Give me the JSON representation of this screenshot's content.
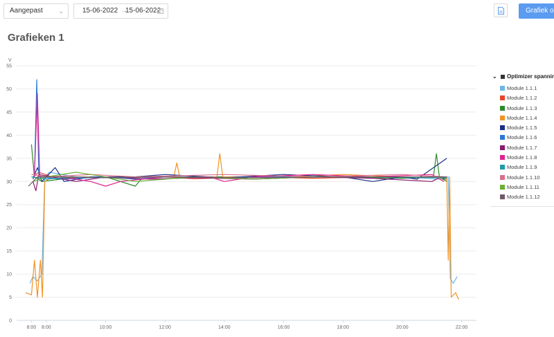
{
  "toolbar": {
    "period_select": "Aangepast",
    "date_from": "15-06-2022",
    "date_arrow": "→",
    "date_to": "15-06-2022",
    "primary_button": "Grafiek ops"
  },
  "page_title": "Grafieken 1",
  "legend": {
    "group_label": "Optimizer spanning",
    "items": [
      {
        "label": "Module 1.1.1",
        "color": "#6cb6e8"
      },
      {
        "label": "Module 1.1.2",
        "color": "#e8452a"
      },
      {
        "label": "Module 1.1.3",
        "color": "#2a8a2a"
      },
      {
        "label": "Module 1.1.4",
        "color": "#f29222"
      },
      {
        "label": "Module 1.1.5",
        "color": "#1b2f8a"
      },
      {
        "label": "Module 1.1.6",
        "color": "#2a78d8"
      },
      {
        "label": "Module 1.1.7",
        "color": "#8a1a6e"
      },
      {
        "label": "Module 1.1.8",
        "color": "#e0238f"
      },
      {
        "label": "Module 1.1.9",
        "color": "#1f9ca8"
      },
      {
        "label": "Module 1.1.10",
        "color": "#d9708a"
      },
      {
        "label": "Module 1.1.11",
        "color": "#6bb035"
      },
      {
        "label": "Module 1.1.12",
        "color": "#6e5a6a"
      }
    ]
  },
  "chart_data": {
    "type": "line",
    "ylabel": "V",
    "ylim": [
      0,
      55
    ],
    "yticks": [
      "0",
      "5",
      "10",
      "15",
      "20",
      "25",
      "30",
      "35",
      "40",
      "45",
      "50",
      "55"
    ],
    "xlim": [
      "7:00",
      "22:30"
    ],
    "xticks": [
      "8:00",
      "8:00",
      "10:00",
      "12:00",
      "14:00",
      "16:00",
      "18:00",
      "20:00",
      "22:00"
    ],
    "grid": "horizontal",
    "series": [
      {
        "name": "Module 1.1.1",
        "color": "#6cb6e8",
        "points": [
          [
            7.45,
            8
          ],
          [
            7.55,
            9.5
          ],
          [
            7.7,
            8.5
          ],
          [
            7.85,
            10
          ],
          [
            7.95,
            31
          ],
          [
            8.1,
            32
          ],
          [
            9,
            31
          ],
          [
            12,
            31
          ],
          [
            16,
            31
          ],
          [
            20,
            31
          ],
          [
            21.3,
            30.5
          ],
          [
            21.55,
            31
          ],
          [
            21.62,
            9
          ],
          [
            21.72,
            8
          ],
          [
            21.85,
            9.5
          ]
        ]
      },
      {
        "name": "Module 1.1.2",
        "color": "#e8452a",
        "points": [
          [
            7.55,
            31
          ],
          [
            7.75,
            32
          ],
          [
            8.4,
            30.5
          ],
          [
            9.2,
            31
          ],
          [
            10.5,
            30.8
          ],
          [
            12,
            31
          ],
          [
            13,
            30.6
          ],
          [
            15,
            31
          ],
          [
            17,
            30.7
          ],
          [
            19,
            31
          ],
          [
            20.5,
            30.8
          ],
          [
            21.5,
            31
          ]
        ]
      },
      {
        "name": "Module 1.1.3",
        "color": "#2a8a2a",
        "points": [
          [
            7.5,
            38
          ],
          [
            7.6,
            31
          ],
          [
            7.85,
            30
          ],
          [
            8.5,
            30.5
          ],
          [
            10,
            31
          ],
          [
            11,
            29
          ],
          [
            11.2,
            30.5
          ],
          [
            12,
            31
          ],
          [
            15,
            31
          ],
          [
            18,
            31
          ],
          [
            20,
            30.7
          ],
          [
            21.05,
            31
          ],
          [
            21.15,
            36
          ],
          [
            21.25,
            31
          ],
          [
            21.5,
            30.5
          ]
        ]
      },
      {
        "name": "Module 1.1.4",
        "color": "#f29222",
        "points": [
          [
            7.3,
            6
          ],
          [
            7.5,
            5.5
          ],
          [
            7.6,
            13
          ],
          [
            7.7,
            5
          ],
          [
            7.8,
            13
          ],
          [
            7.87,
            5
          ],
          [
            7.95,
            30
          ],
          [
            8.2,
            31
          ],
          [
            11,
            31
          ],
          [
            12.3,
            31
          ],
          [
            12.4,
            34
          ],
          [
            12.5,
            31
          ],
          [
            13.75,
            31
          ],
          [
            13.85,
            36
          ],
          [
            13.95,
            31
          ],
          [
            16,
            31
          ],
          [
            18,
            31.5
          ],
          [
            20,
            31
          ],
          [
            21.5,
            31
          ],
          [
            21.55,
            13
          ],
          [
            21.6,
            31
          ],
          [
            21.65,
            5
          ],
          [
            21.8,
            6
          ],
          [
            21.9,
            4.5
          ]
        ]
      },
      {
        "name": "Module 1.1.5",
        "color": "#1b2f8a",
        "points": [
          [
            7.55,
            30.5
          ],
          [
            7.7,
            33
          ],
          [
            7.85,
            30
          ],
          [
            8.3,
            33
          ],
          [
            8.6,
            30
          ],
          [
            9.5,
            31
          ],
          [
            11,
            31
          ],
          [
            12,
            31.5
          ],
          [
            14,
            30.8
          ],
          [
            16,
            31.5
          ],
          [
            18,
            31
          ],
          [
            19,
            30
          ],
          [
            20,
            31
          ],
          [
            20.5,
            30.5
          ],
          [
            21.5,
            35
          ]
        ]
      },
      {
        "name": "Module 1.1.6",
        "color": "#2a78d8",
        "points": [
          [
            7.6,
            31
          ],
          [
            7.68,
            52
          ],
          [
            7.75,
            31
          ],
          [
            8.5,
            30.5
          ],
          [
            10,
            31
          ],
          [
            11,
            30.5
          ],
          [
            12,
            31
          ],
          [
            14,
            30.8
          ],
          [
            16,
            31
          ],
          [
            18,
            31
          ],
          [
            21.5,
            31
          ]
        ]
      },
      {
        "name": "Module 1.1.7",
        "color": "#8a1a6e",
        "points": [
          [
            7.55,
            30
          ],
          [
            7.65,
            28
          ],
          [
            7.75,
            31.5
          ],
          [
            9,
            30
          ],
          [
            10,
            31
          ],
          [
            11.5,
            30.5
          ],
          [
            13,
            30.8
          ],
          [
            15,
            30.5
          ],
          [
            17,
            31
          ],
          [
            19,
            30.7
          ],
          [
            21,
            30
          ],
          [
            21.3,
            31
          ],
          [
            21.5,
            30
          ]
        ]
      },
      {
        "name": "Module 1.1.8",
        "color": "#e0238f",
        "points": [
          [
            7.6,
            31
          ],
          [
            7.7,
            49
          ],
          [
            7.78,
            31
          ],
          [
            8.5,
            31
          ],
          [
            9.5,
            30
          ],
          [
            10,
            29
          ],
          [
            10.5,
            30
          ],
          [
            12,
            31
          ],
          [
            13.5,
            31
          ],
          [
            14,
            30
          ],
          [
            15,
            31
          ],
          [
            17,
            31.5
          ],
          [
            19,
            31
          ],
          [
            21,
            31.5
          ],
          [
            21.4,
            30
          ]
        ]
      },
      {
        "name": "Module 1.1.9",
        "color": "#1f9ca8",
        "points": [
          [
            7.5,
            31
          ],
          [
            8,
            30.5
          ],
          [
            9,
            31
          ],
          [
            10,
            30.8
          ],
          [
            12,
            31
          ],
          [
            15,
            30.8
          ],
          [
            18,
            31
          ],
          [
            21.5,
            30.8
          ]
        ]
      },
      {
        "name": "Module 1.1.10",
        "color": "#d9708a",
        "points": [
          [
            7.5,
            31.5
          ],
          [
            8,
            31
          ],
          [
            9.5,
            31.5
          ],
          [
            11,
            31
          ],
          [
            14,
            31.5
          ],
          [
            17,
            31
          ],
          [
            20,
            31.5
          ],
          [
            21.5,
            31
          ]
        ]
      },
      {
        "name": "Module 1.1.11",
        "color": "#6bb035",
        "points": [
          [
            7.55,
            30
          ],
          [
            8,
            31
          ],
          [
            9,
            32
          ],
          [
            10,
            31
          ],
          [
            11,
            30
          ],
          [
            13,
            31
          ],
          [
            15,
            30.5
          ],
          [
            17,
            31
          ],
          [
            19,
            31
          ],
          [
            21.2,
            31
          ],
          [
            21.5,
            30
          ]
        ]
      },
      {
        "name": "Module 1.1.12",
        "color": "#6e5a6a",
        "points": [
          [
            7.4,
            29
          ],
          [
            7.55,
            30
          ],
          [
            7.7,
            31
          ],
          [
            8.5,
            31
          ],
          [
            10,
            30.8
          ],
          [
            12,
            31
          ],
          [
            15,
            30.8
          ],
          [
            18,
            31
          ],
          [
            21.5,
            31
          ]
        ]
      }
    ]
  }
}
